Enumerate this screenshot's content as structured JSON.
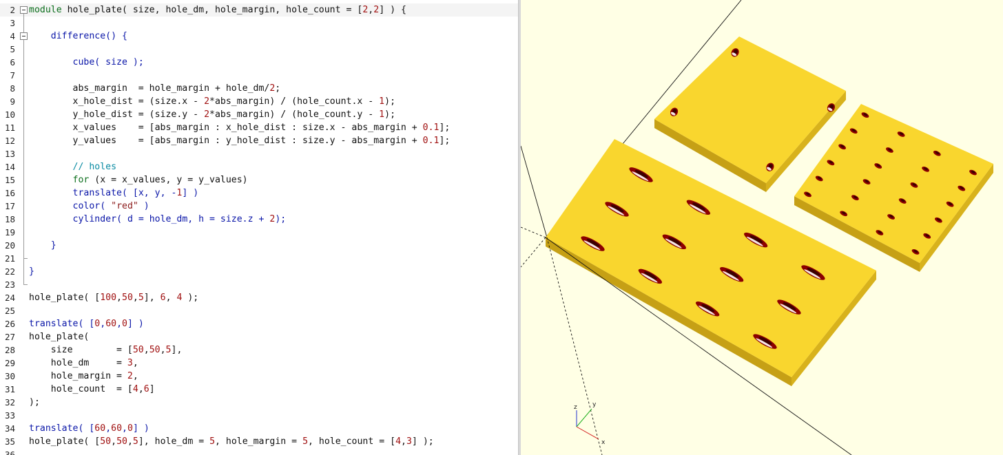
{
  "editor": {
    "lines": [
      {
        "n": "2",
        "fold": "box",
        "current": true,
        "tokens": [
          {
            "t": "module",
            "c": "kw"
          },
          {
            "t": " hole_plate( size, hole_dm, hole_margin, hole_count = [",
            "c": "txt"
          },
          {
            "t": "2",
            "c": "num"
          },
          {
            "t": ",",
            "c": "txt"
          },
          {
            "t": "2",
            "c": "num"
          },
          {
            "t": "] ) {",
            "c": "txt"
          }
        ]
      },
      {
        "n": "3",
        "fold": "line",
        "tokens": []
      },
      {
        "n": "4",
        "fold": "box",
        "tokens": [
          {
            "t": "    ",
            "c": "txt"
          },
          {
            "t": "difference",
            "c": "blue"
          },
          {
            "t": "() {",
            "c": "blue"
          }
        ]
      },
      {
        "n": "5",
        "fold": "line",
        "tokens": []
      },
      {
        "n": "6",
        "fold": "line",
        "tokens": [
          {
            "t": "        ",
            "c": "txt"
          },
          {
            "t": "cube",
            "c": "blue"
          },
          {
            "t": "( size );",
            "c": "blue"
          }
        ]
      },
      {
        "n": "7",
        "fold": "line",
        "tokens": []
      },
      {
        "n": "8",
        "fold": "line",
        "tokens": [
          {
            "t": "        abs_margin  = hole_margin + hole_dm/",
            "c": "txt"
          },
          {
            "t": "2",
            "c": "num"
          },
          {
            "t": ";",
            "c": "txt"
          }
        ]
      },
      {
        "n": "9",
        "fold": "line",
        "tokens": [
          {
            "t": "        x_hole_dist = (size.x - ",
            "c": "txt"
          },
          {
            "t": "2",
            "c": "num"
          },
          {
            "t": "*abs_margin) / (hole_count.x - ",
            "c": "txt"
          },
          {
            "t": "1",
            "c": "num"
          },
          {
            "t": ");",
            "c": "txt"
          }
        ]
      },
      {
        "n": "10",
        "fold": "line",
        "tokens": [
          {
            "t": "        y_hole_dist = (size.y - ",
            "c": "txt"
          },
          {
            "t": "2",
            "c": "num"
          },
          {
            "t": "*abs_margin) / (hole_count.y - ",
            "c": "txt"
          },
          {
            "t": "1",
            "c": "num"
          },
          {
            "t": ");",
            "c": "txt"
          }
        ]
      },
      {
        "n": "11",
        "fold": "line",
        "tokens": [
          {
            "t": "        x_values    = [abs_margin : x_hole_dist : size.x - abs_margin + ",
            "c": "txt"
          },
          {
            "t": "0.1",
            "c": "num"
          },
          {
            "t": "];",
            "c": "txt"
          }
        ]
      },
      {
        "n": "12",
        "fold": "line",
        "tokens": [
          {
            "t": "        y_values    = [abs_margin : y_hole_dist : size.y - abs_margin + ",
            "c": "txt"
          },
          {
            "t": "0.1",
            "c": "num"
          },
          {
            "t": "];",
            "c": "txt"
          }
        ]
      },
      {
        "n": "13",
        "fold": "line",
        "tokens": []
      },
      {
        "n": "14",
        "fold": "line",
        "tokens": [
          {
            "t": "        ",
            "c": "txt"
          },
          {
            "t": "// holes",
            "c": "cm"
          }
        ]
      },
      {
        "n": "15",
        "fold": "line",
        "tokens": [
          {
            "t": "        ",
            "c": "txt"
          },
          {
            "t": "for",
            "c": "kw"
          },
          {
            "t": " (x = x_values, y = y_values)",
            "c": "txt"
          }
        ]
      },
      {
        "n": "16",
        "fold": "line",
        "tokens": [
          {
            "t": "        ",
            "c": "txt"
          },
          {
            "t": "translate",
            "c": "blue"
          },
          {
            "t": "( [x, y, -",
            "c": "blue"
          },
          {
            "t": "1",
            "c": "num"
          },
          {
            "t": "] )",
            "c": "blue"
          }
        ]
      },
      {
        "n": "17",
        "fold": "line",
        "tokens": [
          {
            "t": "        ",
            "c": "txt"
          },
          {
            "t": "color",
            "c": "blue"
          },
          {
            "t": "( ",
            "c": "blue"
          },
          {
            "t": "\"red\"",
            "c": "str"
          },
          {
            "t": " )",
            "c": "blue"
          }
        ]
      },
      {
        "n": "18",
        "fold": "line",
        "tokens": [
          {
            "t": "        ",
            "c": "txt"
          },
          {
            "t": "cylinder",
            "c": "blue"
          },
          {
            "t": "( d = hole_dm, h = size.z + ",
            "c": "blue"
          },
          {
            "t": "2",
            "c": "num"
          },
          {
            "t": ");",
            "c": "blue"
          }
        ]
      },
      {
        "n": "19",
        "fold": "line",
        "tokens": []
      },
      {
        "n": "20",
        "fold": "line",
        "tokens": [
          {
            "t": "    ",
            "c": "txt"
          },
          {
            "t": "}",
            "c": "blue"
          }
        ]
      },
      {
        "n": "21",
        "fold": "end",
        "tokens": []
      },
      {
        "n": "22",
        "fold": "line",
        "tokens": [
          {
            "t": "}",
            "c": "blue"
          }
        ]
      },
      {
        "n": "23",
        "fold": "end",
        "tokens": []
      },
      {
        "n": "24",
        "fold": "none",
        "tokens": [
          {
            "t": "hole_plate( [",
            "c": "txt"
          },
          {
            "t": "100",
            "c": "num"
          },
          {
            "t": ",",
            "c": "txt"
          },
          {
            "t": "50",
            "c": "num"
          },
          {
            "t": ",",
            "c": "txt"
          },
          {
            "t": "5",
            "c": "num"
          },
          {
            "t": "], ",
            "c": "txt"
          },
          {
            "t": "6",
            "c": "num"
          },
          {
            "t": ", ",
            "c": "txt"
          },
          {
            "t": "4",
            "c": "num"
          },
          {
            "t": " );",
            "c": "txt"
          }
        ]
      },
      {
        "n": "25",
        "fold": "none",
        "tokens": []
      },
      {
        "n": "26",
        "fold": "none",
        "tokens": [
          {
            "t": "translate",
            "c": "blue"
          },
          {
            "t": "( [",
            "c": "blue"
          },
          {
            "t": "0",
            "c": "num"
          },
          {
            "t": ",",
            "c": "blue"
          },
          {
            "t": "60",
            "c": "num"
          },
          {
            "t": ",",
            "c": "blue"
          },
          {
            "t": "0",
            "c": "num"
          },
          {
            "t": "] )",
            "c": "blue"
          }
        ]
      },
      {
        "n": "27",
        "fold": "none",
        "tokens": [
          {
            "t": "hole_plate(",
            "c": "txt"
          }
        ]
      },
      {
        "n": "28",
        "fold": "none",
        "tokens": [
          {
            "t": "    size        = [",
            "c": "txt"
          },
          {
            "t": "50",
            "c": "num"
          },
          {
            "t": ",",
            "c": "txt"
          },
          {
            "t": "50",
            "c": "num"
          },
          {
            "t": ",",
            "c": "txt"
          },
          {
            "t": "5",
            "c": "num"
          },
          {
            "t": "],",
            "c": "txt"
          }
        ]
      },
      {
        "n": "29",
        "fold": "none",
        "tokens": [
          {
            "t": "    hole_dm     = ",
            "c": "txt"
          },
          {
            "t": "3",
            "c": "num"
          },
          {
            "t": ",",
            "c": "txt"
          }
        ]
      },
      {
        "n": "30",
        "fold": "none",
        "tokens": [
          {
            "t": "    hole_margin = ",
            "c": "txt"
          },
          {
            "t": "2",
            "c": "num"
          },
          {
            "t": ",",
            "c": "txt"
          }
        ]
      },
      {
        "n": "31",
        "fold": "none",
        "tokens": [
          {
            "t": "    hole_count  = [",
            "c": "txt"
          },
          {
            "t": "4",
            "c": "num"
          },
          {
            "t": ",",
            "c": "txt"
          },
          {
            "t": "6",
            "c": "num"
          },
          {
            "t": "]",
            "c": "txt"
          }
        ]
      },
      {
        "n": "32",
        "fold": "none",
        "tokens": [
          {
            "t": ");",
            "c": "txt"
          }
        ]
      },
      {
        "n": "33",
        "fold": "none",
        "tokens": []
      },
      {
        "n": "34",
        "fold": "none",
        "tokens": [
          {
            "t": "translate",
            "c": "blue"
          },
          {
            "t": "( [",
            "c": "blue"
          },
          {
            "t": "60",
            "c": "num"
          },
          {
            "t": ",",
            "c": "blue"
          },
          {
            "t": "60",
            "c": "num"
          },
          {
            "t": ",",
            "c": "blue"
          },
          {
            "t": "0",
            "c": "num"
          },
          {
            "t": "] )",
            "c": "blue"
          }
        ]
      },
      {
        "n": "35",
        "fold": "none",
        "tokens": [
          {
            "t": "hole_plate( [",
            "c": "txt"
          },
          {
            "t": "50",
            "c": "num"
          },
          {
            "t": ",",
            "c": "txt"
          },
          {
            "t": "50",
            "c": "num"
          },
          {
            "t": ",",
            "c": "txt"
          },
          {
            "t": "5",
            "c": "num"
          },
          {
            "t": "], hole_dm = ",
            "c": "txt"
          },
          {
            "t": "5",
            "c": "num"
          },
          {
            "t": ", hole_margin = ",
            "c": "txt"
          },
          {
            "t": "5",
            "c": "num"
          },
          {
            "t": ", hole_count = [",
            "c": "txt"
          },
          {
            "t": "4",
            "c": "num"
          },
          {
            "t": ",",
            "c": "txt"
          },
          {
            "t": "3",
            "c": "num"
          },
          {
            "t": "] );",
            "c": "txt"
          }
        ]
      },
      {
        "n": "36",
        "fold": "none",
        "tokens": []
      }
    ]
  },
  "viewport": {
    "axes_labels": {
      "x": "x",
      "y": "y",
      "z": "z"
    },
    "colors": {
      "background": "#ffffe5",
      "plate_top": "#f9d62e",
      "plate_side": "#d8b21c",
      "plate_front": "#c6a015",
      "hole": "#8c0000",
      "hole_deep": "#3c0000",
      "axis_x": "#d42020",
      "axis_y": "#20b020",
      "axis_z": "#2030d0"
    },
    "plates": [
      {
        "name": "plate-100x50",
        "size": [
          100,
          50,
          5
        ],
        "hole_dm": 6,
        "hole_count": [
          2,
          2
        ]
      },
      {
        "name": "plate-50x50-small-holes",
        "size": [
          50,
          50,
          5
        ],
        "hole_dm": 3,
        "hole_count": [
          4,
          6
        ]
      },
      {
        "name": "plate-50x50-large-holes",
        "size": [
          50,
          50,
          5
        ],
        "hole_dm": 5,
        "hole_count": [
          4,
          3
        ]
      }
    ]
  }
}
